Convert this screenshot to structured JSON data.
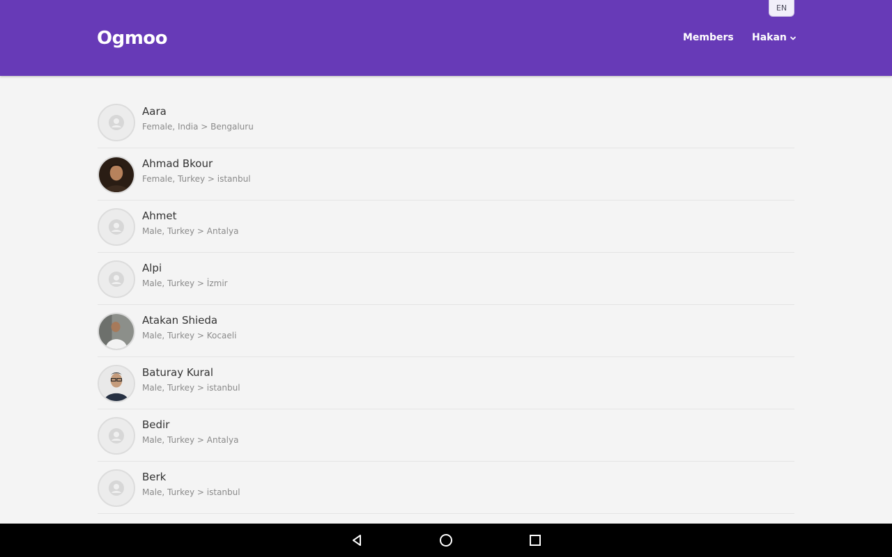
{
  "header": {
    "logo": "Ogmoo",
    "language": "EN",
    "nav_members": "Members",
    "nav_user": "Hakan",
    "bg_color": "#673ab7"
  },
  "members": [
    {
      "name": "Aara",
      "details": "Female, India > Bengaluru",
      "avatar": "placeholder"
    },
    {
      "name": "Ahmad Bkour",
      "details": "Female, Turkey > istanbul",
      "avatar": "photo"
    },
    {
      "name": "Ahmet",
      "details": "Male, Turkey > Antalya",
      "avatar": "placeholder"
    },
    {
      "name": "Alpi",
      "details": "Male, Turkey > İzmir",
      "avatar": "placeholder"
    },
    {
      "name": "Atakan Shieda",
      "details": "Male, Turkey > Kocaeli",
      "avatar": "photo"
    },
    {
      "name": "Baturay Kural",
      "details": "Male, Turkey > istanbul",
      "avatar": "photo"
    },
    {
      "name": "Bedir",
      "details": "Male, Turkey > Antalya",
      "avatar": "placeholder"
    },
    {
      "name": "Berk",
      "details": "Male, Turkey > istanbul",
      "avatar": "placeholder"
    }
  ],
  "system_nav": {
    "back": "back-triangle-icon",
    "home": "home-circle-icon",
    "recents": "recents-square-icon"
  }
}
